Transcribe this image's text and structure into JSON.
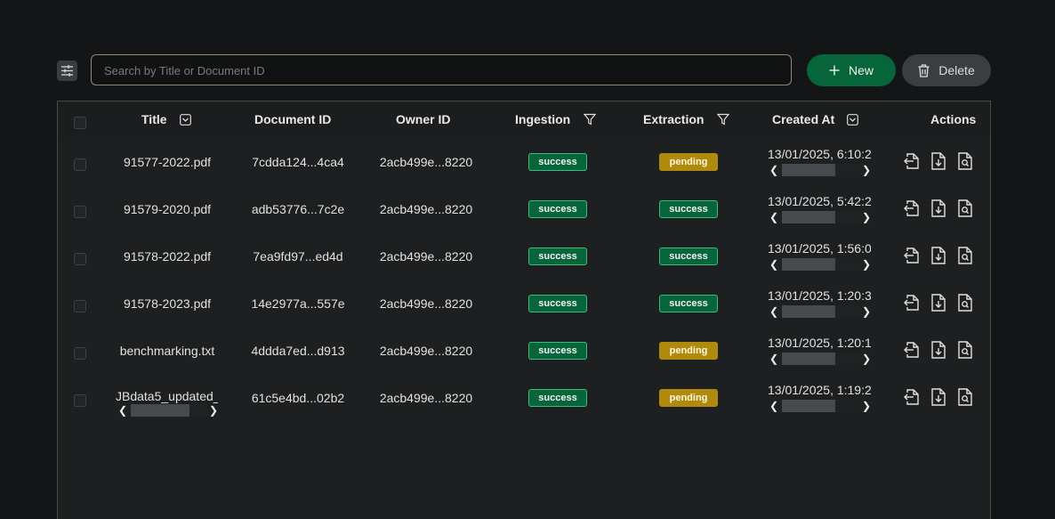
{
  "search": {
    "placeholder": "Search by Title or Document ID",
    "value": ""
  },
  "toolbar": {
    "new_label": "New",
    "delete_label": "Delete"
  },
  "table": {
    "columns": {
      "title": "Title",
      "document_id": "Document ID",
      "owner_id": "Owner ID",
      "ingestion": "Ingestion",
      "extraction": "Extraction",
      "created_at": "Created At",
      "actions": "Actions"
    },
    "rows": [
      {
        "title": "91577-2022.pdf",
        "document_id": "7cdda124...4ca4",
        "owner_id": "2acb499e...8220",
        "ingestion": "success",
        "extraction": "pending",
        "created_at": "13/01/2025, 6:10:2"
      },
      {
        "title": "91579-2020.pdf",
        "document_id": "adb53776...7c2e",
        "owner_id": "2acb499e...8220",
        "ingestion": "success",
        "extraction": "success",
        "created_at": "13/01/2025, 5:42:2"
      },
      {
        "title": "91578-2022.pdf",
        "document_id": "7ea9fd97...ed4d",
        "owner_id": "2acb499e...8220",
        "ingestion": "success",
        "extraction": "success",
        "created_at": "13/01/2025, 1:56:0"
      },
      {
        "title": "91578-2023.pdf",
        "document_id": "14e2977a...557e",
        "owner_id": "2acb499e...8220",
        "ingestion": "success",
        "extraction": "success",
        "created_at": "13/01/2025, 1:20:3"
      },
      {
        "title": "benchmarking.txt",
        "document_id": "4ddda7ed...d913",
        "owner_id": "2acb499e...8220",
        "ingestion": "success",
        "extraction": "pending",
        "created_at": "13/01/2025, 1:20:1"
      },
      {
        "title": "JBdata5_updated_",
        "document_id": "61c5e4bd...02b2",
        "owner_id": "2acb499e...8220",
        "ingestion": "success",
        "extraction": "pending",
        "created_at": "13/01/2025, 1:19:2"
      }
    ]
  },
  "colors": {
    "success": "#07653c",
    "pending": "#b08a0c",
    "accent": "#07653c"
  },
  "icons": {
    "settings": "sliders-icon",
    "new": "plus-icon",
    "delete": "trash-icon",
    "sort": "sort-dropdown-icon",
    "filter": "filter-icon",
    "actions": [
      "file-export-icon",
      "file-download-icon",
      "file-search-icon"
    ]
  }
}
